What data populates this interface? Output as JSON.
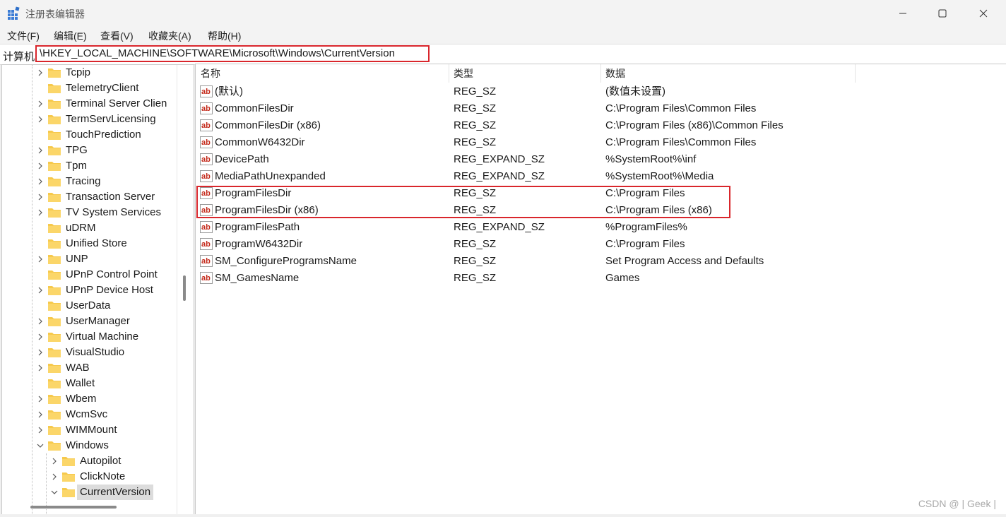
{
  "window": {
    "title": "注册表编辑器",
    "icon": "registry-editor-icon",
    "controls": {
      "minimize": "minimize-icon",
      "maximize": "maximize-icon",
      "close": "close-icon"
    }
  },
  "menu": {
    "items": [
      "文件(F)",
      "编辑(E)",
      "查看(V)",
      "收藏夹(A)",
      "帮助(H)"
    ]
  },
  "address": {
    "prefix": "计算机",
    "path": "\\HKEY_LOCAL_MACHINE\\SOFTWARE\\Microsoft\\Windows\\CurrentVersion"
  },
  "tree": {
    "items": [
      {
        "label": "Tcpip",
        "expandable": true,
        "level": 1
      },
      {
        "label": "TelemetryClient",
        "expandable": false,
        "level": 1
      },
      {
        "label": "Terminal Server Clien",
        "expandable": true,
        "level": 1
      },
      {
        "label": "TermServLicensing",
        "expandable": true,
        "level": 1
      },
      {
        "label": "TouchPrediction",
        "expandable": false,
        "level": 1
      },
      {
        "label": "TPG",
        "expandable": true,
        "level": 1
      },
      {
        "label": "Tpm",
        "expandable": true,
        "level": 1
      },
      {
        "label": "Tracing",
        "expandable": true,
        "level": 1
      },
      {
        "label": "Transaction Server",
        "expandable": true,
        "level": 1
      },
      {
        "label": "TV System Services",
        "expandable": true,
        "level": 1
      },
      {
        "label": "uDRM",
        "expandable": false,
        "level": 1
      },
      {
        "label": "Unified Store",
        "expandable": false,
        "level": 1
      },
      {
        "label": "UNP",
        "expandable": true,
        "level": 1
      },
      {
        "label": "UPnP Control Point",
        "expandable": false,
        "level": 1
      },
      {
        "label": "UPnP Device Host",
        "expandable": true,
        "level": 1
      },
      {
        "label": "UserData",
        "expandable": false,
        "level": 1
      },
      {
        "label": "UserManager",
        "expandable": true,
        "level": 1
      },
      {
        "label": "Virtual Machine",
        "expandable": true,
        "level": 1
      },
      {
        "label": "VisualStudio",
        "expandable": true,
        "level": 1
      },
      {
        "label": "WAB",
        "expandable": true,
        "level": 1
      },
      {
        "label": "Wallet",
        "expandable": false,
        "level": 1
      },
      {
        "label": "Wbem",
        "expandable": true,
        "level": 1
      },
      {
        "label": "WcmSvc",
        "expandable": true,
        "level": 1
      },
      {
        "label": "WIMMount",
        "expandable": true,
        "level": 1
      },
      {
        "label": "Windows",
        "expandable": true,
        "expanded": true,
        "level": 1
      },
      {
        "label": "Autopilot",
        "expandable": true,
        "level": 2
      },
      {
        "label": "ClickNote",
        "expandable": true,
        "level": 2
      },
      {
        "label": "CurrentVersion",
        "expandable": true,
        "expanded": true,
        "selected": true,
        "level": 2
      }
    ]
  },
  "list": {
    "headers": {
      "name": "名称",
      "type": "类型",
      "data": "数据"
    },
    "rows": [
      {
        "name": "(默认)",
        "type": "REG_SZ",
        "data": "(数值未设置)"
      },
      {
        "name": "CommonFilesDir",
        "type": "REG_SZ",
        "data": "C:\\Program Files\\Common Files"
      },
      {
        "name": "CommonFilesDir (x86)",
        "type": "REG_SZ",
        "data": "C:\\Program Files (x86)\\Common Files"
      },
      {
        "name": "CommonW6432Dir",
        "type": "REG_SZ",
        "data": "C:\\Program Files\\Common Files"
      },
      {
        "name": "DevicePath",
        "type": "REG_EXPAND_SZ",
        "data": "%SystemRoot%\\inf"
      },
      {
        "name": "MediaPathUnexpanded",
        "type": "REG_EXPAND_SZ",
        "data": "%SystemRoot%\\Media"
      },
      {
        "name": "ProgramFilesDir",
        "type": "REG_SZ",
        "data": "C:\\Program Files"
      },
      {
        "name": "ProgramFilesDir (x86)",
        "type": "REG_SZ",
        "data": "C:\\Program Files (x86)"
      },
      {
        "name": "ProgramFilesPath",
        "type": "REG_EXPAND_SZ",
        "data": "%ProgramFiles%"
      },
      {
        "name": "ProgramW6432Dir",
        "type": "REG_SZ",
        "data": "C:\\Program Files"
      },
      {
        "name": "SM_ConfigureProgramsName",
        "type": "REG_SZ",
        "data": "Set Program Access and Defaults"
      },
      {
        "name": "SM_GamesName",
        "type": "REG_SZ",
        "data": "Games"
      }
    ],
    "value_icon": "string-value-icon"
  },
  "watermark": "CSDN @ | Geek |",
  "colors": {
    "highlight": "#d9262c",
    "folder": "#f6c94c",
    "value_icon": "#c42b1c"
  }
}
